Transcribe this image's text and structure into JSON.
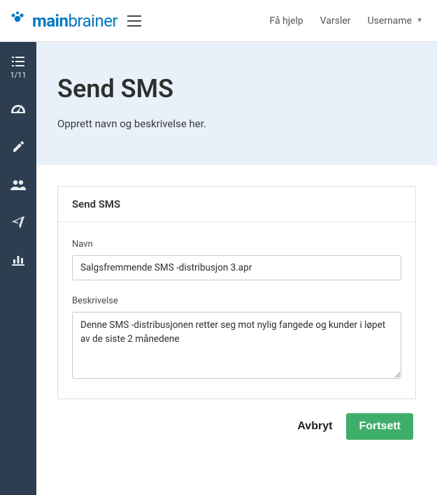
{
  "topbar": {
    "logo_main": "main",
    "logo_sub": "brainer",
    "help_label": "Få hjelp",
    "alerts_label": "Varsler",
    "username_label": "Username"
  },
  "sidebar": {
    "steps_indicator": "1/11"
  },
  "hero": {
    "title": "Send SMS",
    "subtitle": "Opprett navn og beskrivelse her."
  },
  "card": {
    "header": "Send SMS",
    "name_label": "Navn",
    "name_value": "Salgsfremmende SMS -distribusjon 3.apr",
    "desc_label": "Beskrivelse",
    "desc_value": "Denne SMS -distribusjonen retter seg mot nylig fangede og kunder i løpet av de siste 2 månedene"
  },
  "actions": {
    "cancel": "Avbryt",
    "continue": "Fortsett"
  }
}
